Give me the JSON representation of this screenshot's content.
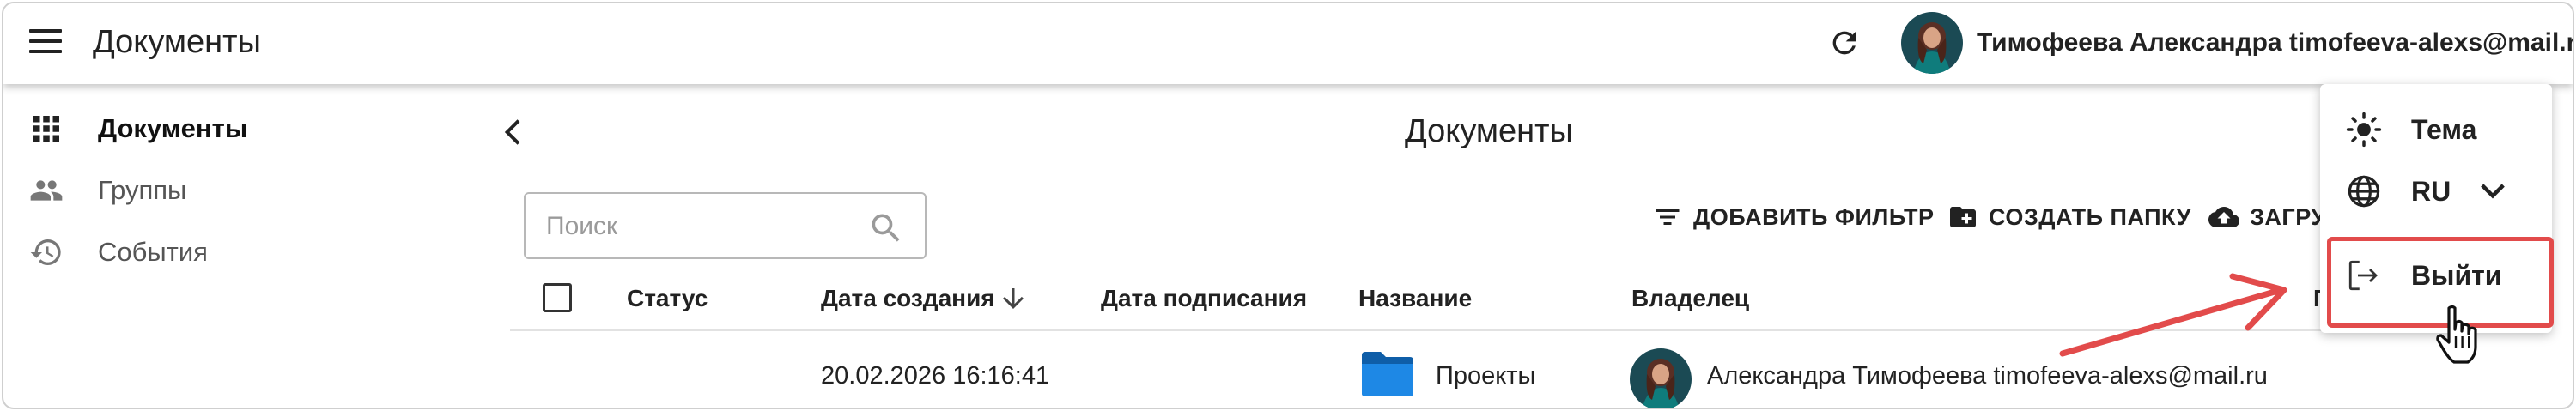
{
  "header": {
    "title": "Документы",
    "menu_icon": "hamburger-menu-icon",
    "refresh_icon": "refresh-icon",
    "user": "Тимофеева Александра timofeeva-alexs@mail.ru"
  },
  "sidebar": {
    "items": [
      {
        "label": "Документы",
        "icon": "apps-grid-icon",
        "active": true
      },
      {
        "label": "Группы",
        "icon": "people-icon",
        "active": false
      },
      {
        "label": "События",
        "icon": "history-icon",
        "active": false
      }
    ]
  },
  "main": {
    "title": "Документы",
    "search_placeholder": "Поиск",
    "toolbar": {
      "add_filter": "ДОБАВИТЬ ФИЛЬТР",
      "create_folder": "СОЗДАТЬ ПАПКУ",
      "upload": "ЗАГРУ"
    },
    "table": {
      "columns": [
        "Статус",
        "Дата создания",
        "Дата подписания",
        "Название",
        "Владелец",
        "П"
      ],
      "rows": [
        {
          "status": "",
          "created": "20.02.2026 16:16:41",
          "signed": "",
          "name": "Проекты",
          "owner": "Александра Тимофеева timofeeva-alexs@mail.ru"
        }
      ]
    }
  },
  "menu": {
    "theme": "Тема",
    "language": "RU",
    "logout": "Выйти"
  },
  "colors": {
    "highlight": "#e24b4b",
    "folder": "#1e88e5",
    "text": "#222222"
  }
}
